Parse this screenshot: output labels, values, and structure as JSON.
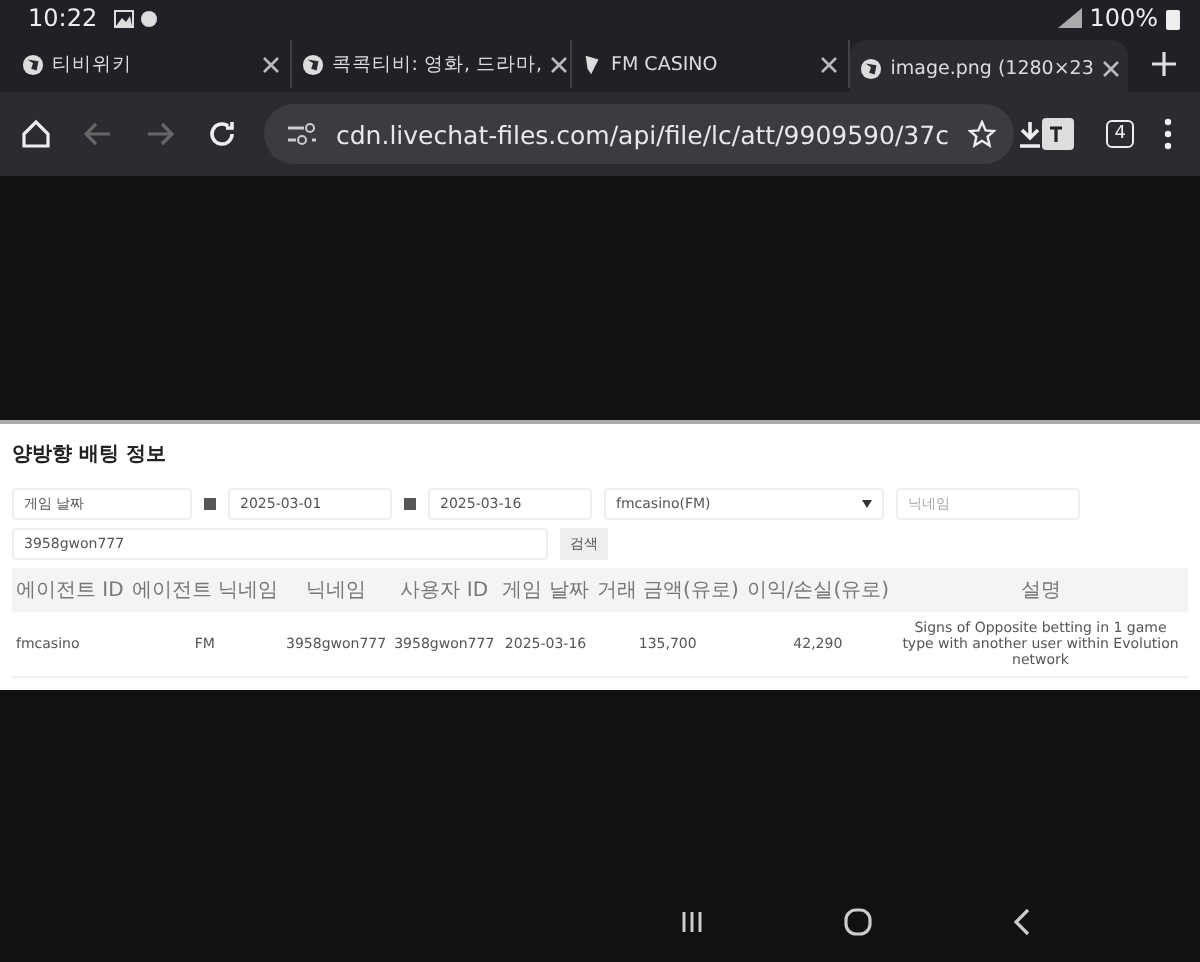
{
  "status_bar": {
    "time": "10:22",
    "battery": "100%"
  },
  "tabs": [
    {
      "label": "티비위키",
      "selected": false
    },
    {
      "label": "콕콕티비: 영화, 드라마,",
      "selected": false
    },
    {
      "label": "FM CASINO",
      "selected": false
    },
    {
      "label": "image.png (1280×23",
      "selected": true
    }
  ],
  "address_bar": {
    "url": "cdn.livechat-files.com/api/file/lc/att/9909590/37c",
    "tab_count": "4"
  },
  "page": {
    "title": "양방향 배팅 정보",
    "filters": {
      "date_type": "게임 날짜",
      "start_date": "2025-03-01",
      "end_date": "2025-03-16",
      "agent": "fmcasino(FM)",
      "nickname_placeholder": "닉네임",
      "user_value": "3958gwon777",
      "search_button": "검색"
    },
    "table": {
      "columns": [
        "에이전트 ID",
        "에이전트 닉네임",
        "닉네임",
        "사용자 ID",
        "게임 날짜",
        "거래 금액(유로)",
        "이익/손실(유로)",
        "설명"
      ],
      "rows": [
        [
          "fmcasino",
          "FM",
          "3958gwon777",
          "3958gwon777",
          "2025-03-16",
          "135,700",
          "42,290",
          "Signs of Opposite betting in 1 game type with another user within Evolution network"
        ]
      ]
    }
  }
}
